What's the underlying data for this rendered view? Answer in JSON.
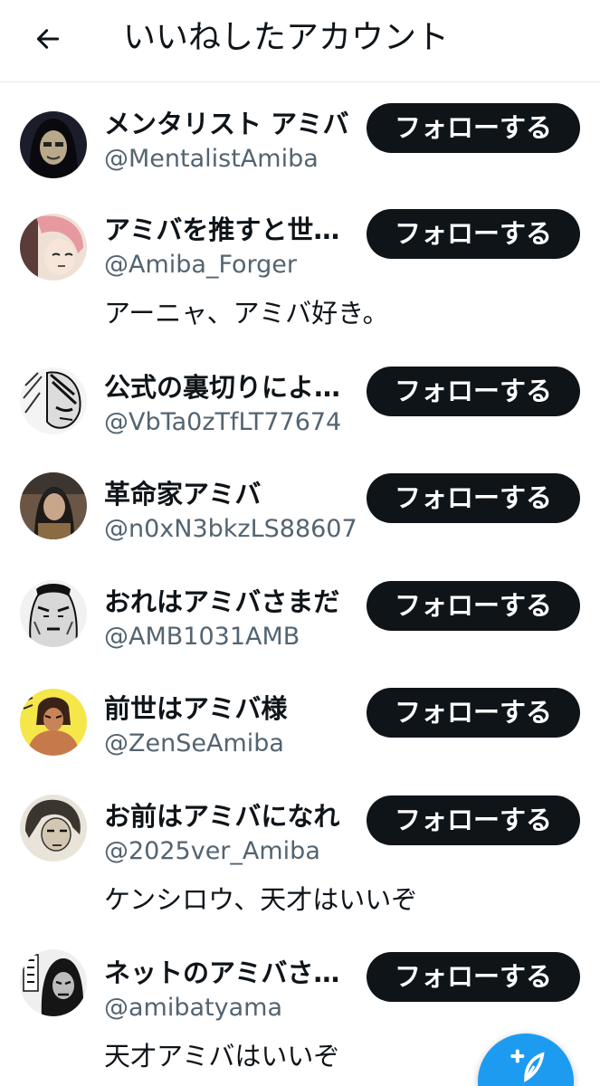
{
  "header": {
    "title": "いいねしたアカウント",
    "back_icon": "arrow-left-icon"
  },
  "users": [
    {
      "name": "メンタリスト アミバ",
      "handle": "@MentalistAmiba",
      "bio": "",
      "follow_label": "フォローする"
    },
    {
      "name": "アミバを推すと世…",
      "handle": "@Amiba_Forger",
      "bio": "アーニャ、アミバ好き。",
      "follow_label": "フォローする"
    },
    {
      "name": "公式の裏切りによ…",
      "handle": "@VbTa0zTfLT77674",
      "bio": "",
      "follow_label": "フォローする"
    },
    {
      "name": "革命家アミバ",
      "handle": "@n0xN3bkzLS88607",
      "bio": "",
      "follow_label": "フォローする"
    },
    {
      "name": "おれはアミバさまだ",
      "handle": "@AMB1031AMB",
      "bio": "",
      "follow_label": "フォローする"
    },
    {
      "name": "前世はアミバ様",
      "handle": "@ZenSeAmiba",
      "bio": "",
      "follow_label": "フォローする"
    },
    {
      "name": "お前はアミバになれ",
      "handle": "@2025ver_Amiba",
      "bio": "ケンシロウ、天才はいいぞ",
      "follow_label": "フォローする"
    },
    {
      "name": "ネットのアミバさ…",
      "handle": "@amibatyama",
      "bio": "天才アミバはいいぞ",
      "follow_label": "フォローする"
    }
  ],
  "fab": {
    "icon": "compose-plus-icon",
    "color": "#1d9bf0"
  },
  "colors": {
    "button_bg": "#0f1419",
    "handle": "#536471",
    "accent": "#1d9bf0"
  }
}
